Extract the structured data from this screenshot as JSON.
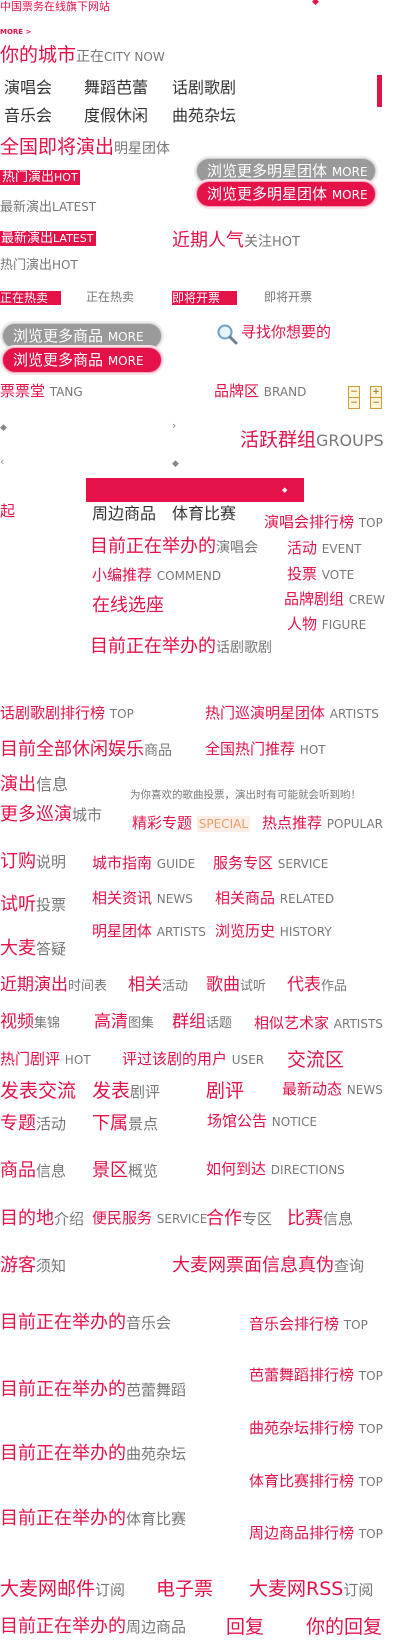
{
  "header": {
    "subtitle": "中国票务在线旗下网站",
    "more": "MORE >"
  },
  "city": {
    "title": "你的城市",
    "now_cn": "正在",
    "now_en": "CITY NOW"
  },
  "genres": [
    "演唱会",
    "舞蹈芭蕾",
    "话剧歌剧",
    "音乐会",
    "度假休闲",
    "曲苑杂坛"
  ],
  "upcoming": {
    "title": "全国即将演出",
    "suffix": "明星团体"
  },
  "pills": {
    "browse_more": "浏览更多",
    "artists": "明星团体",
    "goods": "商品",
    "more": "MORE"
  },
  "labels": {
    "hot_show": "热门演出",
    "hot": "HOT",
    "latest_show": "最新演出",
    "latest": "LATEST",
    "recent": "近期人气",
    "follow": "关注",
    "hot2": "HOT",
    "selling": "正在热卖",
    "opening": "即将开票",
    "search": "寻找你想要的",
    "ticket_hall": "票票堂",
    "tang": "TANG",
    "brand": "品牌区",
    "brand_en": "BRAND",
    "groups_cn": "活跃群组",
    "groups_en": "GROUPS",
    "qi": "起",
    "peripheral": "周边商品",
    "sports": "体育比赛",
    "concert_rank": "演唱会排行榜",
    "top": "TOP",
    "holding_prefix": "目前正在举办的",
    "concert": "演唱会",
    "drama": "话剧歌剧",
    "music": "音乐会",
    "ballet": "芭蕾舞蹈",
    "quyuan": "曲苑杂坛",
    "sports_suffix": "体育比赛",
    "goods_suffix": "周边商品",
    "activity": "活动",
    "event": "EVENT",
    "editor": "小编推荐",
    "commend": "COMMEND",
    "vote": "投票",
    "vote_en": "VOTE",
    "seat": "在线选座",
    "crew_cn": "品牌剧组",
    "crew_en": "CREW",
    "figure_cn": "人物",
    "figure_en": "FIGURE",
    "drama_rank": "话剧歌剧排行榜",
    "tour_artists": "热门巡演明星团体",
    "artists_en": "ARTISTS",
    "leisure": "目前全部休闲娱乐",
    "goods2": "商品",
    "national_hot": "全国热门推荐",
    "show_info_r": "演出",
    "show_info_g": "信息",
    "vote_note": "为你喜欢的歌曲投票，演出时有可能就会听到哟！",
    "more_tour_r": "更多巡演",
    "more_tour_g": "城市",
    "special_cn": "精彩专题",
    "special_en": "SPECIAL",
    "popular_cn": "热点推荐",
    "popular_en": "POPULAR",
    "order_r": "订购",
    "order_g": "说明",
    "guide_cn": "城市指南",
    "guide_en": "GUIDE",
    "service_cn": "服务专区",
    "service_en": "SERVICE",
    "listen_r": "试听",
    "listen_g": "投票",
    "news_cn": "相关资讯",
    "news_en": "NEWS",
    "related_cn": "相关商品",
    "related_en": "RELATED",
    "artists_cn": "明星团体",
    "history_cn": "浏览历史",
    "history_en": "HISTORY",
    "faq_r": "大麦",
    "faq_g": "答疑",
    "schedule_r": "近期演出",
    "schedule_g": "时间表",
    "rel_act_r": "相关",
    "rel_act_g": "活动",
    "song_r": "歌曲",
    "song_g": "试听",
    "works_r": "代表",
    "works_g": "作品",
    "video_r": "视频",
    "video_g": "集锦",
    "gallery_r": "高清",
    "gallery_g": "图集",
    "topic_r": "群组",
    "topic_g": "话题",
    "rel_artists_cn": "相似艺术家",
    "review_cn": "热门剧评",
    "users_cn": "评过该剧的用户",
    "users_en": "USER",
    "exchange": "交流区",
    "post_r": "发表交流",
    "post2_r": "发表",
    "post2_g": "剧评",
    "review2": "剧评",
    "latest_news_cn": "最新动态",
    "latest_news_en": "NEWS",
    "special2_r": "专题",
    "special2_g": "活动",
    "sub_r": "下属",
    "sub_g": "景点",
    "notice_cn": "场馆公告",
    "notice_en": "NOTICE",
    "goods_info_r": "商品",
    "goods_info_g": "信息",
    "scenic_r": "景区",
    "scenic_g": "概览",
    "directions_cn": "如何到达",
    "directions_en": "DIRECTIONS",
    "dest_r": "目的地",
    "dest_g": "介绍",
    "convenient_cn": "便民服务",
    "convenient_en": "SERVICE",
    "coop_r": "合作",
    "coop_g": "专区",
    "match_r": "比赛",
    "match_g": "信息",
    "tourist_r": "游客",
    "tourist_g": "须知",
    "verify_r": "大麦网票面信息真伪",
    "verify_g": "查询",
    "music_rank": "音乐会排行榜",
    "ballet_rank": "芭蕾舞蹈排行榜",
    "quyuan_rank": "曲苑杂坛排行榜",
    "sports_rank": "体育比赛排行榜",
    "goods_rank": "周边商品排行榜",
    "mail_r": "大麦网邮件",
    "mail_g": "订阅",
    "eticket": "电子票",
    "rss_r": "大麦网RSS",
    "rss_g": "订阅",
    "reply": "回复",
    "your_reply_r": "你的回复"
  },
  "icons": {
    "search": "magnifier-icon",
    "minus": "minus-icon",
    "plus": "plus-icon"
  },
  "colors": {
    "accent": "#e5124a",
    "gray": "#9a9a9a",
    "text": "#333333"
  }
}
